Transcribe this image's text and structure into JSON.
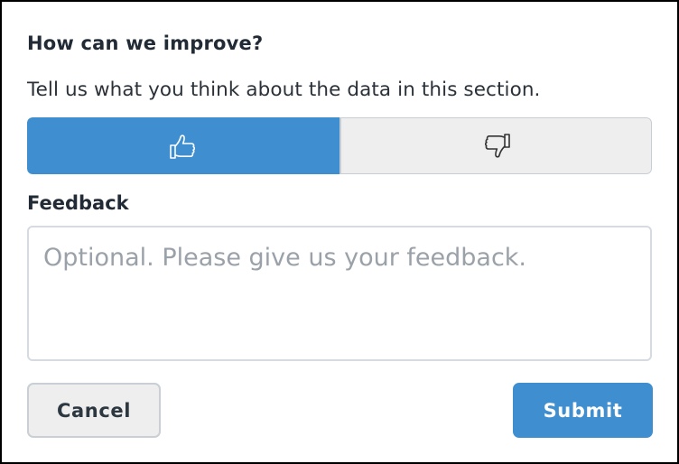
{
  "dialog": {
    "title": "How can we improve?",
    "subtitle": "Tell us what you think about the data in this section.",
    "rating": {
      "selected": "thumbs-up",
      "options": [
        {
          "icon": "thumbs-up-icon"
        },
        {
          "icon": "thumbs-down-icon"
        }
      ]
    },
    "feedback_label": "Feedback",
    "feedback_input": {
      "value": "",
      "placeholder": "Optional. Please give us your feedback."
    },
    "cancel_label": "Cancel",
    "submit_label": "Submit"
  },
  "colors": {
    "accent": "#3f8fd0",
    "button_secondary_bg": "#eeeeee",
    "border": "#c9cfd4",
    "text": "#222b35"
  }
}
